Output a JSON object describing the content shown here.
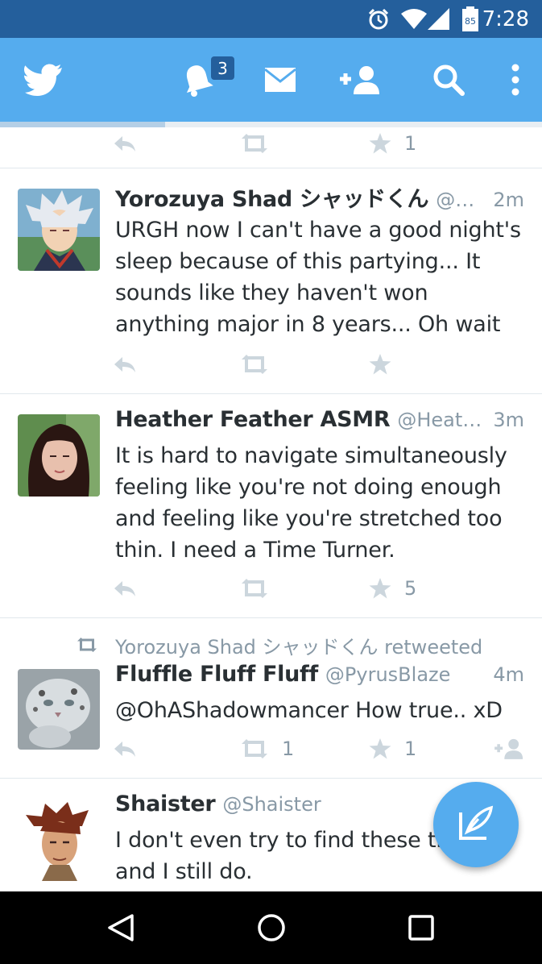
{
  "status_bar": {
    "time": "7:28",
    "battery_level": "85",
    "icons": [
      "alarm-icon",
      "wifi-icon",
      "signal-icon",
      "battery-icon"
    ]
  },
  "app_bar": {
    "notification_badge": "3",
    "icons": [
      "twitter-bird-icon",
      "notifications-bell-icon",
      "messages-envelope-icon",
      "add-user-icon",
      "search-icon",
      "overflow-menu-icon"
    ],
    "accent_color": "#55acee",
    "status_color": "#245f9c"
  },
  "timeline": {
    "partial_top_actions": {
      "favorites_count": "1"
    },
    "tweets": [
      {
        "name": "Yorozuya Shad シャッドくん",
        "handle": "@O...",
        "time": "2m",
        "text": "URGH now I can't have a good night's sleep because of this partying... It sounds like they haven't won anything major in 8 years... Oh wait",
        "retweets": "",
        "favorites": ""
      },
      {
        "name": "Heather Feather ASMR",
        "handle": "@HeathFe...",
        "time": "3m",
        "text": "It is hard to navigate simultaneously feeling like you're not doing enough and feeling like you're stretched too thin. I need a Time Turner.",
        "retweets": "",
        "favorites": "5"
      },
      {
        "retweeted_by": "Yorozuya Shad シャッドくん retweeted",
        "name": "Fluffle Fluff Fluff",
        "handle": "@PyrusBlaze",
        "time": "4m",
        "text": "@OhAShadowmancer How true.. xD",
        "retweets": "1",
        "favorites": "1"
      },
      {
        "name": "Shaister",
        "handle": "@Shaister",
        "time": "",
        "text_line1": "I don't even try to find these th",
        "text_line2": "and I still do."
      }
    ]
  },
  "fab": {
    "icon": "compose-tweet-icon"
  },
  "nav_bar": {
    "icons": [
      "back-icon",
      "home-icon",
      "recents-icon"
    ]
  }
}
